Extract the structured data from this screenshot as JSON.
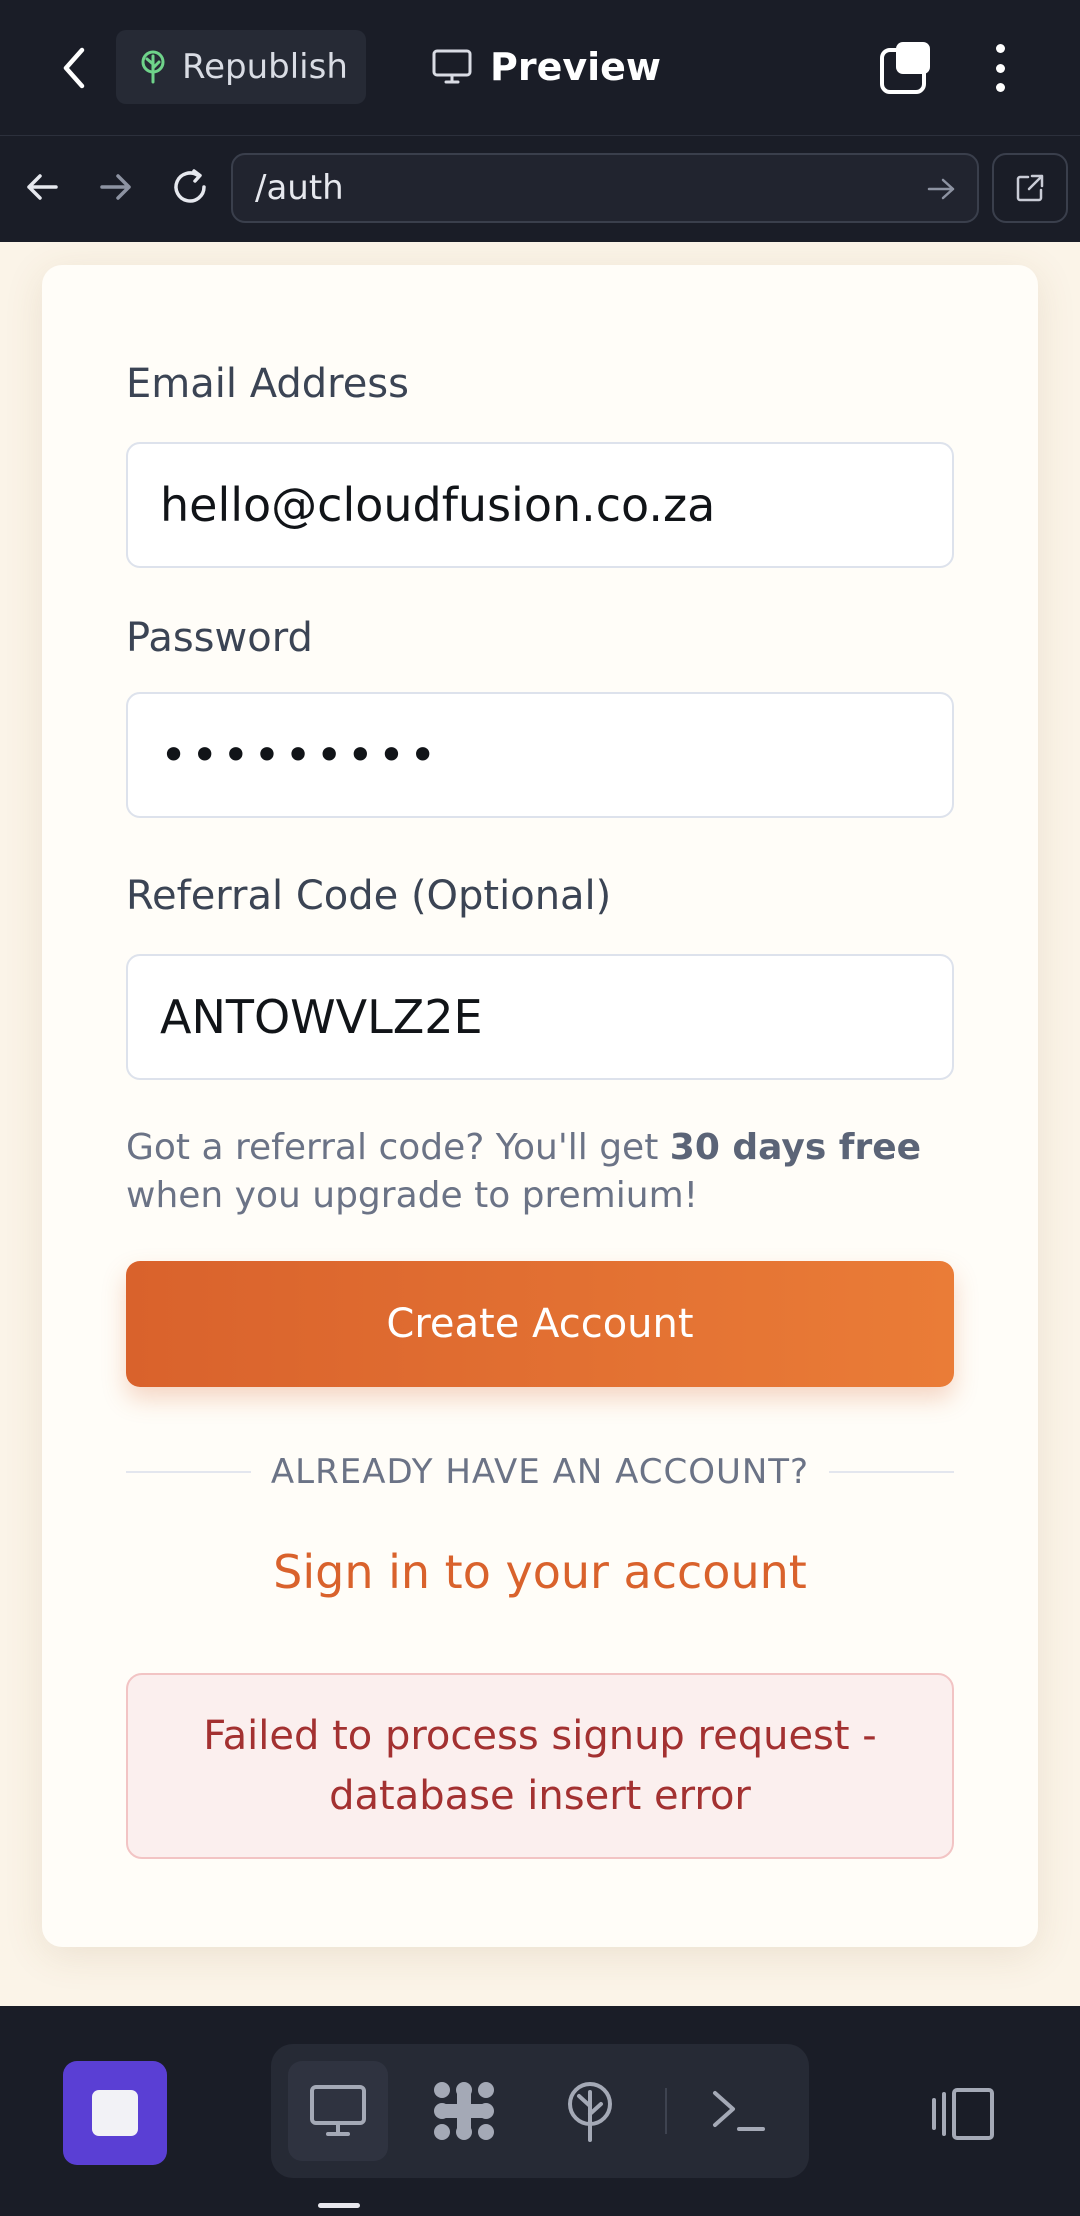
{
  "header": {
    "republish_label": "Republish",
    "preview_label": "Preview"
  },
  "browser": {
    "url": "/auth"
  },
  "form": {
    "email_label": "Email Address",
    "email_value": "hello@cloudfusion.co.za",
    "password_label": "Password",
    "password_value": "•••••••••",
    "referral_label": "Referral Code (Optional)",
    "referral_value": "ANTOWVLZ2E",
    "hint_prefix": "Got a referral code? You'll get ",
    "hint_bold": "30 days free",
    "hint_suffix": " when you upgrade to premium!",
    "submit_label": "Create Account",
    "divider_text": "ALREADY HAVE AN ACCOUNT?",
    "signin_link": "Sign in to your account",
    "error_message": "Failed to process signup request - database insert error"
  },
  "colors": {
    "accent": "#d9622c",
    "error_text": "#a33131",
    "stop_button": "#5a3fd4"
  },
  "icons": {
    "back": "chevron-left-icon",
    "republish": "tree-icon",
    "preview": "monitor-icon",
    "tabs": "tabs-icon",
    "more": "kebab-icon",
    "nav_back": "arrow-left-icon",
    "nav_forward": "arrow-right-icon",
    "reload": "reload-icon",
    "go": "arrow-right-icon",
    "external": "external-link-icon",
    "stop": "stop-icon",
    "desktop": "monitor-icon",
    "network": "network-icon",
    "deploy": "deploy-icon",
    "terminal": "terminal-icon",
    "panel": "panel-icon"
  }
}
